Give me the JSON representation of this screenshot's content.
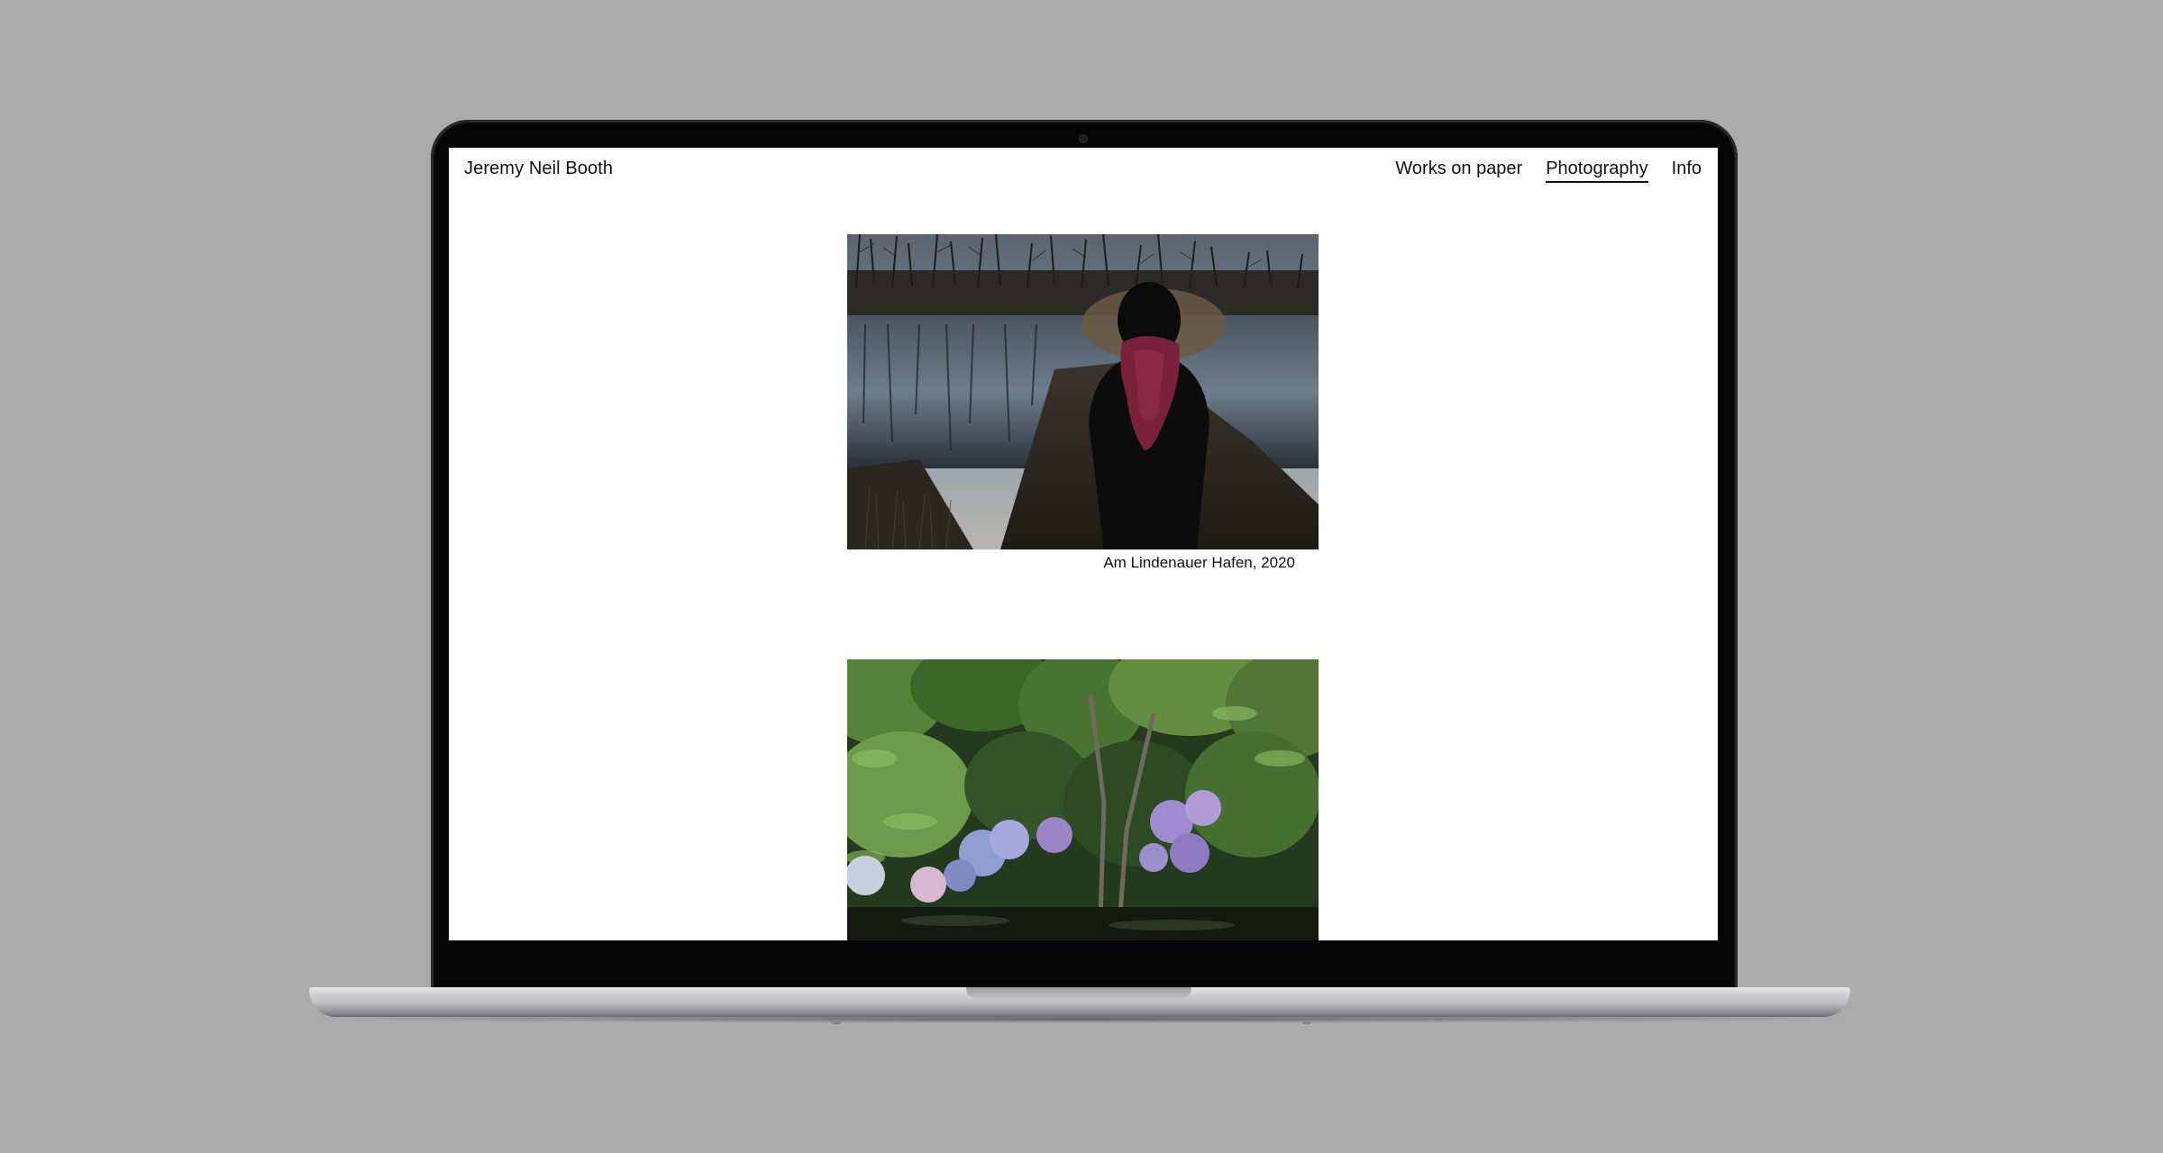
{
  "site": {
    "title": "Jeremy Neil Booth"
  },
  "nav": {
    "items": [
      {
        "label": "Works on paper",
        "active": false
      },
      {
        "label": "Photography",
        "active": true
      },
      {
        "label": "Info",
        "active": false
      }
    ]
  },
  "gallery": {
    "items": [
      {
        "caption": "Am Lindenauer Hafen, 2020"
      },
      {
        "caption": ""
      }
    ]
  },
  "colors": {
    "background": "#ababab",
    "page": "#ffffff",
    "text": "#111111",
    "bezel": "#050505"
  }
}
